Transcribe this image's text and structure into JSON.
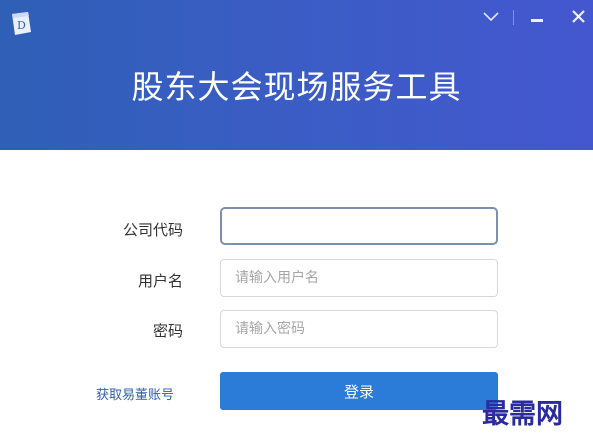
{
  "window": {
    "title": "股东大会现场服务工具",
    "icons": {
      "app": "app-logo-icon",
      "collapse": "chevron-down-icon",
      "minimize": "minimize-icon",
      "close": "close-icon"
    },
    "colors": {
      "header_start": "#2f5fb6",
      "header_end": "#4457cf",
      "primary_button": "#2b7bd8",
      "link": "#2f5fa8"
    }
  },
  "form": {
    "company_code": {
      "label": "公司代码",
      "value": "",
      "placeholder": ""
    },
    "username": {
      "label": "用户名",
      "value": "",
      "placeholder": "请输入用户名"
    },
    "password": {
      "label": "密码",
      "value": "",
      "placeholder": "请输入密码"
    },
    "get_account_link": "获取易董账号",
    "login_button": "登录"
  },
  "watermark": {
    "text": "最需网"
  }
}
